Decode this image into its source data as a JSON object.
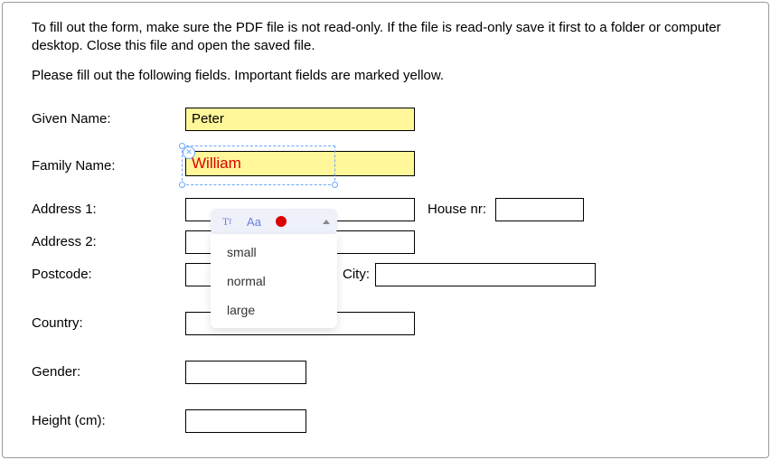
{
  "instructions": {
    "p1": "To fill out the form, make sure the PDF file is not read-only. If the file is read-only save it first to a folder or computer desktop. Close this file and open the saved file.",
    "p2": "Please fill out the following fields. Important fields are marked yellow."
  },
  "fields": {
    "given_name": {
      "label": "Given Name:",
      "value": "Peter"
    },
    "family_name": {
      "label": "Family Name:",
      "value": "William"
    },
    "address1": {
      "label": "Address 1:",
      "value": ""
    },
    "house_nr": {
      "label": "House nr:",
      "value": ""
    },
    "address2": {
      "label": "Address 2:",
      "value": ""
    },
    "postcode": {
      "label": "Postcode:",
      "value": ""
    },
    "city": {
      "label": "City:",
      "value": ""
    },
    "country": {
      "label": "Country:",
      "value": ""
    },
    "gender": {
      "label": "Gender:",
      "value": ""
    },
    "height": {
      "label": "Height (cm):",
      "value": ""
    }
  },
  "toolbar": {
    "font_family_hint": "T",
    "size_options": [
      "small",
      "normal",
      "large"
    ]
  }
}
